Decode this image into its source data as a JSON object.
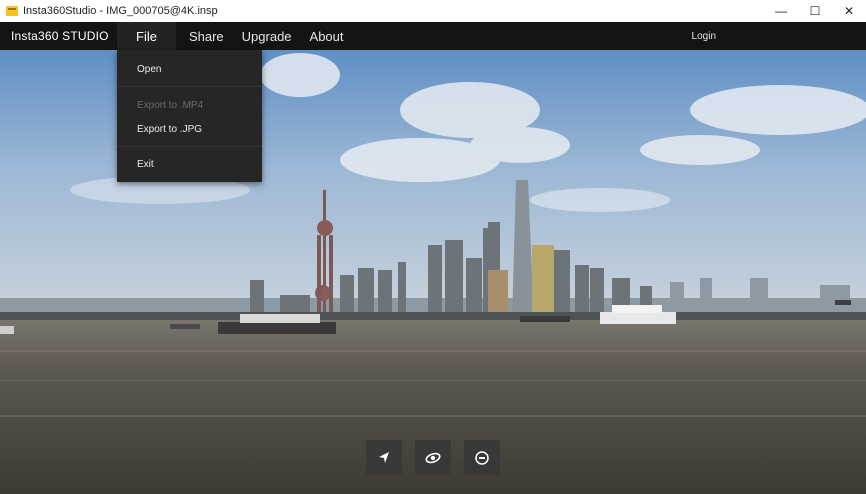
{
  "window": {
    "title": "Insta360Studio - IMG_000705@4K.insp",
    "minimize": "—",
    "maximize": "☐",
    "close": "✕"
  },
  "menubar": {
    "logo": "Insta360 STUDIO",
    "items": [
      {
        "label": "File",
        "active": true
      },
      {
        "label": "Share"
      },
      {
        "label": "Upgrade"
      },
      {
        "label": "About"
      }
    ],
    "login": "Login"
  },
  "file_menu": {
    "items": [
      {
        "label": "Open",
        "enabled": true
      },
      {
        "label": "Export to .MP4",
        "enabled": false
      },
      {
        "label": "Export to .JPG",
        "enabled": true
      },
      {
        "label": "Exit",
        "enabled": true
      }
    ]
  },
  "controls": [
    {
      "name": "pointer-mode",
      "icon": "cursor-arrow-icon"
    },
    {
      "name": "rotate-view",
      "icon": "rotate-planet-icon"
    },
    {
      "name": "360-view",
      "icon": "360-icon"
    }
  ],
  "colors": {
    "menubar_bg": "#141414",
    "dropdown_bg": "#262626",
    "disabled_text": "#6b6b6b"
  }
}
